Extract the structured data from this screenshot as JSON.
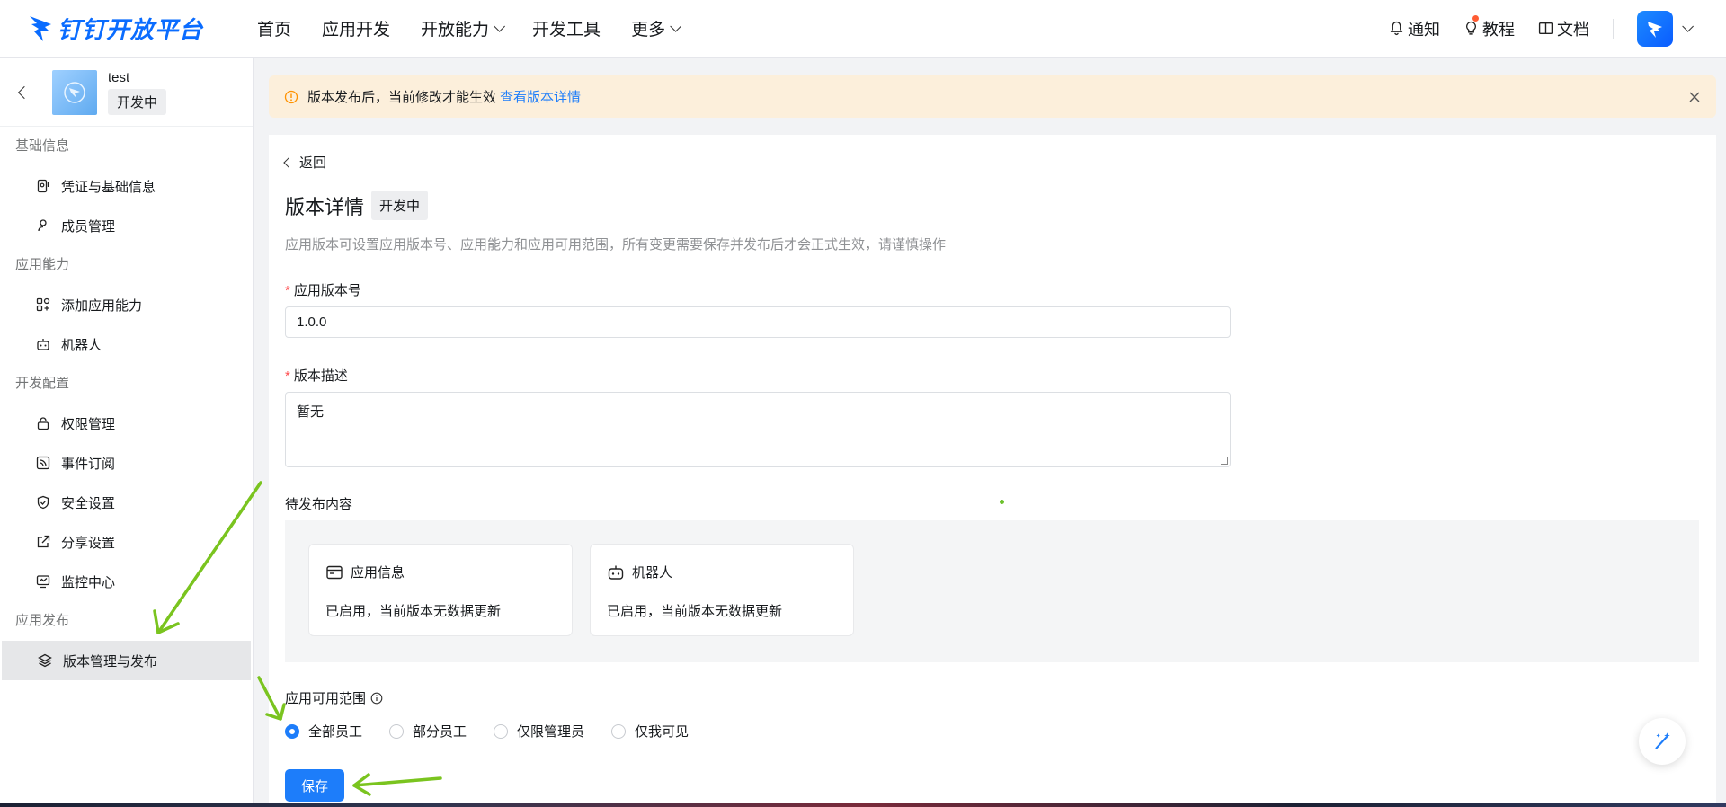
{
  "brand": {
    "logo_text": "钉钉开放平台"
  },
  "nav": [
    {
      "label": "首页",
      "has_dropdown": false
    },
    {
      "label": "应用开发",
      "has_dropdown": false
    },
    {
      "label": "开放能力",
      "has_dropdown": true
    },
    {
      "label": "开发工具",
      "has_dropdown": false
    },
    {
      "label": "更多",
      "has_dropdown": true
    }
  ],
  "top_right": {
    "notify": "通知",
    "tutorial": "教程",
    "docs": "文档"
  },
  "app": {
    "name": "test",
    "status": "开发中"
  },
  "sidebar": {
    "sections": [
      {
        "title": "基础信息",
        "items": [
          {
            "label": "凭证与基础信息",
            "icon": "credential-icon"
          },
          {
            "label": "成员管理",
            "icon": "user-icon"
          }
        ]
      },
      {
        "title": "应用能力",
        "items": [
          {
            "label": "添加应用能力",
            "icon": "add-capability-icon"
          },
          {
            "label": "机器人",
            "icon": "robot-icon"
          }
        ]
      },
      {
        "title": "开发配置",
        "items": [
          {
            "label": "权限管理",
            "icon": "lock-icon"
          },
          {
            "label": "事件订阅",
            "icon": "rss-icon"
          },
          {
            "label": "安全设置",
            "icon": "shield-icon"
          },
          {
            "label": "分享设置",
            "icon": "share-icon"
          },
          {
            "label": "监控中心",
            "icon": "monitor-icon"
          }
        ]
      },
      {
        "title": "应用发布",
        "items": [
          {
            "label": "版本管理与发布",
            "icon": "layers-icon",
            "active": true
          }
        ]
      }
    ]
  },
  "notice": {
    "text": "版本发布后，当前修改才能生效",
    "link": "查看版本详情"
  },
  "main": {
    "back": "返回",
    "title": "版本详情",
    "title_tag": "开发中",
    "description": "应用版本可设置应用版本号、应用能力和应用可用范围，所有变更需要保存并发布后才会正式生效，请谨慎操作",
    "version_label": "应用版本号",
    "version_value": "1.0.0",
    "desc_label": "版本描述",
    "desc_value": "暂无",
    "pending_label": "待发布内容",
    "pending": [
      {
        "title": "应用信息",
        "status": "已启用，当前版本无数据更新",
        "icon": "app-info-icon"
      },
      {
        "title": "机器人",
        "status": "已启用，当前版本无数据更新",
        "icon": "robot-icon"
      }
    ],
    "range_label": "应用可用范围",
    "range_options": [
      {
        "label": "全部员工",
        "checked": true
      },
      {
        "label": "部分员工",
        "checked": false
      },
      {
        "label": "仅限管理员",
        "checked": false
      },
      {
        "label": "仅我可见",
        "checked": false
      }
    ],
    "save": "保存"
  },
  "colors": {
    "primary": "#1d7dfa",
    "notice_bg": "#fcefdb",
    "annotation_arrow": "#7ac41f"
  }
}
